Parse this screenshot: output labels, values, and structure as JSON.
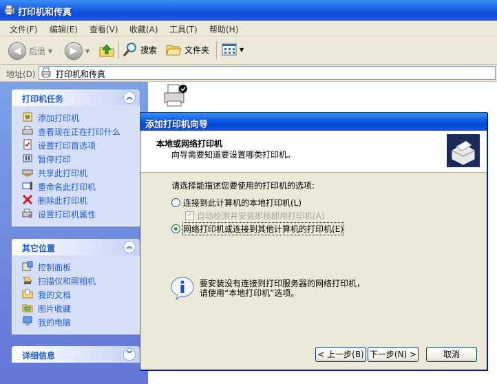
{
  "window": {
    "title": "打印机和传真"
  },
  "menu": [
    "文件(F)",
    "编辑(E)",
    "查看(V)",
    "收藏(A)",
    "工具(T)",
    "帮助(H)"
  ],
  "toolbar": {
    "back": "后退",
    "search": "搜索",
    "folders": "文件夹"
  },
  "address": {
    "label": "地址(D)",
    "value": "打印机和传真"
  },
  "tasks_panel": {
    "title": "打印机任务",
    "items": [
      "添加打印机",
      "查看现在正在打印什么",
      "设置打印首选项",
      "暂停打印",
      "共享此打印机",
      "重命名此打印机",
      "删除此打印机",
      "设置打印机属性"
    ]
  },
  "other_panel": {
    "title": "其它位置",
    "items": [
      "控制面板",
      "扫描仪和照相机",
      "我的文档",
      "图片收藏",
      "我的电脑"
    ]
  },
  "details_panel": {
    "title": "详细信息"
  },
  "dialog": {
    "title": "添加打印机向导",
    "heading": "本地或网络打印机",
    "subheading": "向导需要知道要设置哪类打印机。",
    "prompt": "请选择能描述您要使用的打印机的选项:",
    "option_local": "连接到此计算机的本地打印机(L)",
    "option_autodetect": "自动检测并安装即插即用打印机(A)",
    "option_network": "网络打印机或连接到其他计算机的打印机(E)",
    "selected_option": "network",
    "info_text_1": "要安装没有连接到打印服务器的网络打印机，",
    "info_text_2": "请使用“本地打印机”选项。",
    "btn_back": "< 上一步(B)",
    "btn_next": "下一步(N) >",
    "btn_cancel": "取消"
  }
}
